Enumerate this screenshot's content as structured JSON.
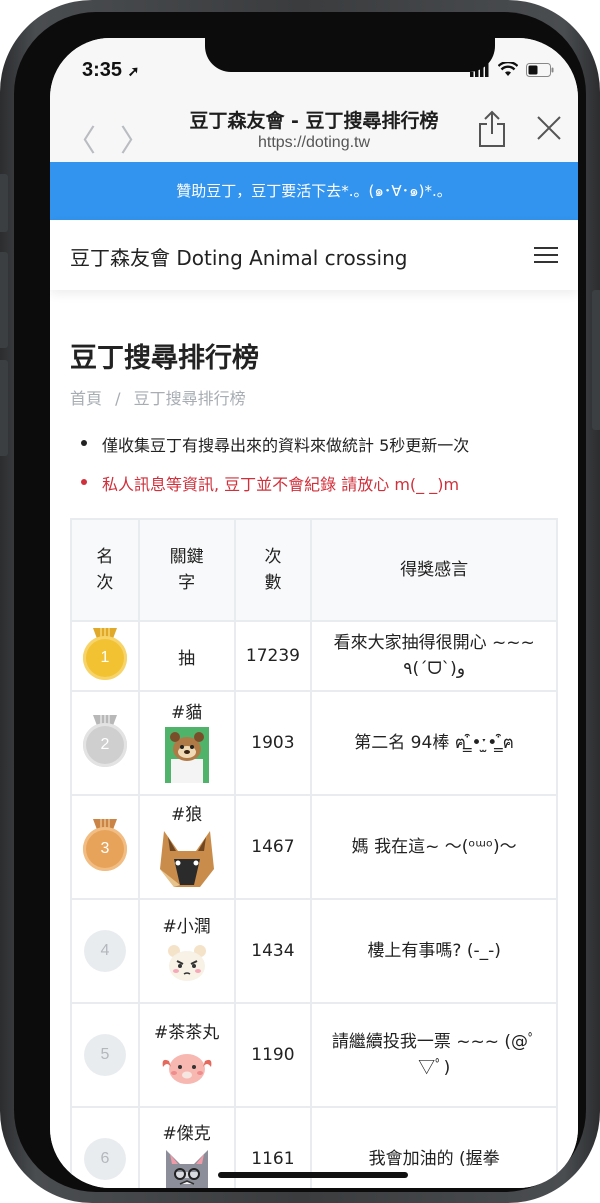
{
  "status": {
    "time": "3:35",
    "location_arrow": "➚"
  },
  "browser": {
    "back_label": "〈",
    "forward_label": "〉",
    "title": "豆丁森友會 - 豆丁搜尋排行榜",
    "url": "https://doting.tw"
  },
  "sponsor_text": "贊助豆丁，豆丁要活下去*.。(๑･∀･๑)*.。",
  "site": {
    "title": "豆丁森友會 Doting Animal crossing",
    "menu_icon": "hamburger-icon"
  },
  "page": {
    "title": "豆丁搜尋排行榜",
    "breadcrumb": [
      "首頁",
      "/",
      "豆丁搜尋排行榜"
    ],
    "notes": [
      "僅收集豆丁有搜尋出來的資料來做統計 5秒更新一次",
      "私人訊息等資訊, 豆丁並不會紀錄 請放心 m(_ _)m"
    ]
  },
  "table": {
    "headers": {
      "rank_line1": "名",
      "rank_line2": "次",
      "keyword_line1": "關鍵",
      "keyword_line2": "字",
      "count_line1": "次",
      "count_line2": "數",
      "message": "得獎感言"
    },
    "rows": [
      {
        "rank": "1",
        "keyword": "抽",
        "count": "17239",
        "message": "看來大家抽得很開心 ~~~ ٩(ˊᗜˋ)و"
      },
      {
        "rank": "2",
        "keyword": "#貓",
        "count": "1903",
        "message": "第二名 94棒 ฅ ̳͒•ˑ̫• ̳͒ฅ"
      },
      {
        "rank": "3",
        "keyword": "#狼",
        "count": "1467",
        "message": "媽 我在這~ ～(ᵒᵚᵒ)～"
      },
      {
        "rank": "4",
        "keyword": "#小潤",
        "count": "1434",
        "message": "樓上有事嗎? (-_-)"
      },
      {
        "rank": "5",
        "keyword": "#茶茶丸",
        "count": "1190",
        "message": "請繼續投我一票 ~~~ (@ﾟ▽ﾟ)"
      },
      {
        "rank": "6",
        "keyword": "#傑克",
        "count": "1161",
        "message": "我會加油的 (握拳"
      }
    ]
  },
  "colors": {
    "sponsor": "#3294ee",
    "red_note": "#d0303b",
    "gold": "#f2c232",
    "silver": "#cfcfcf",
    "bronze": "#e8a35b"
  }
}
